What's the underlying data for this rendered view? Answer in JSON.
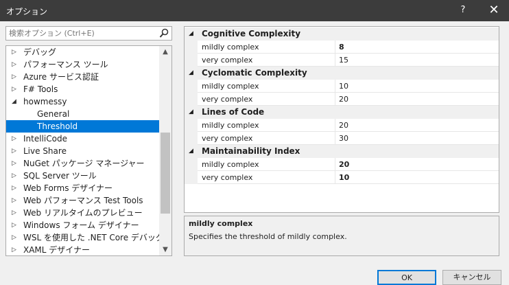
{
  "window": {
    "title": "オプション",
    "help": "?",
    "close": "✕"
  },
  "search": {
    "placeholder": "検索オプション (Ctrl+E)"
  },
  "tree": {
    "items": [
      {
        "label": "デバッグ",
        "arrow": "▷"
      },
      {
        "label": "パフォーマンス ツール",
        "arrow": "▷"
      },
      {
        "label": "Azure サービス認証",
        "arrow": "▷"
      },
      {
        "label": "F# Tools",
        "arrow": "▷"
      },
      {
        "label": "howmessy",
        "arrow": "◢"
      },
      {
        "label": "General",
        "arrow": ""
      },
      {
        "label": "Threshold",
        "arrow": ""
      },
      {
        "label": "IntelliCode",
        "arrow": "▷"
      },
      {
        "label": "Live Share",
        "arrow": "▷"
      },
      {
        "label": "NuGet パッケージ マネージャー",
        "arrow": "▷"
      },
      {
        "label": "SQL Server ツール",
        "arrow": "▷"
      },
      {
        "label": "Web Forms デザイナー",
        "arrow": "▷"
      },
      {
        "label": "Web パフォーマンス Test Tools",
        "arrow": "▷"
      },
      {
        "label": "Web リアルタイムのプレビュー",
        "arrow": "▷"
      },
      {
        "label": "Windows フォーム デザイナー",
        "arrow": "▷"
      },
      {
        "label": "WSL を使用した .NET Core デバッグ",
        "arrow": "▷"
      },
      {
        "label": "XAML デザイナー",
        "arrow": "▷"
      }
    ],
    "selected": "Threshold",
    "scroll_up": "▲",
    "scroll_down": "▼"
  },
  "grid": {
    "categories": [
      {
        "name": "Cognitive Complexity",
        "props": [
          {
            "name": "mildly complex",
            "value": "8",
            "bold": true
          },
          {
            "name": "very complex",
            "value": "15",
            "bold": false
          }
        ]
      },
      {
        "name": "Cyclomatic Complexity",
        "props": [
          {
            "name": "mildly complex",
            "value": "10",
            "bold": false
          },
          {
            "name": "very complex",
            "value": "20",
            "bold": false
          }
        ]
      },
      {
        "name": "Lines of Code",
        "props": [
          {
            "name": "mildly complex",
            "value": "20",
            "bold": false
          },
          {
            "name": "very complex",
            "value": "30",
            "bold": false
          }
        ]
      },
      {
        "name": "Maintainability Index",
        "props": [
          {
            "name": "mildly complex",
            "value": "20",
            "bold": true
          },
          {
            "name": "very complex",
            "value": "10",
            "bold": true
          }
        ]
      }
    ],
    "expanded_glyph": "◢"
  },
  "description": {
    "title": "mildly complex",
    "text": "Specifies the threshold of mildly complex."
  },
  "buttons": {
    "ok": "OK",
    "cancel": "キャンセル"
  }
}
